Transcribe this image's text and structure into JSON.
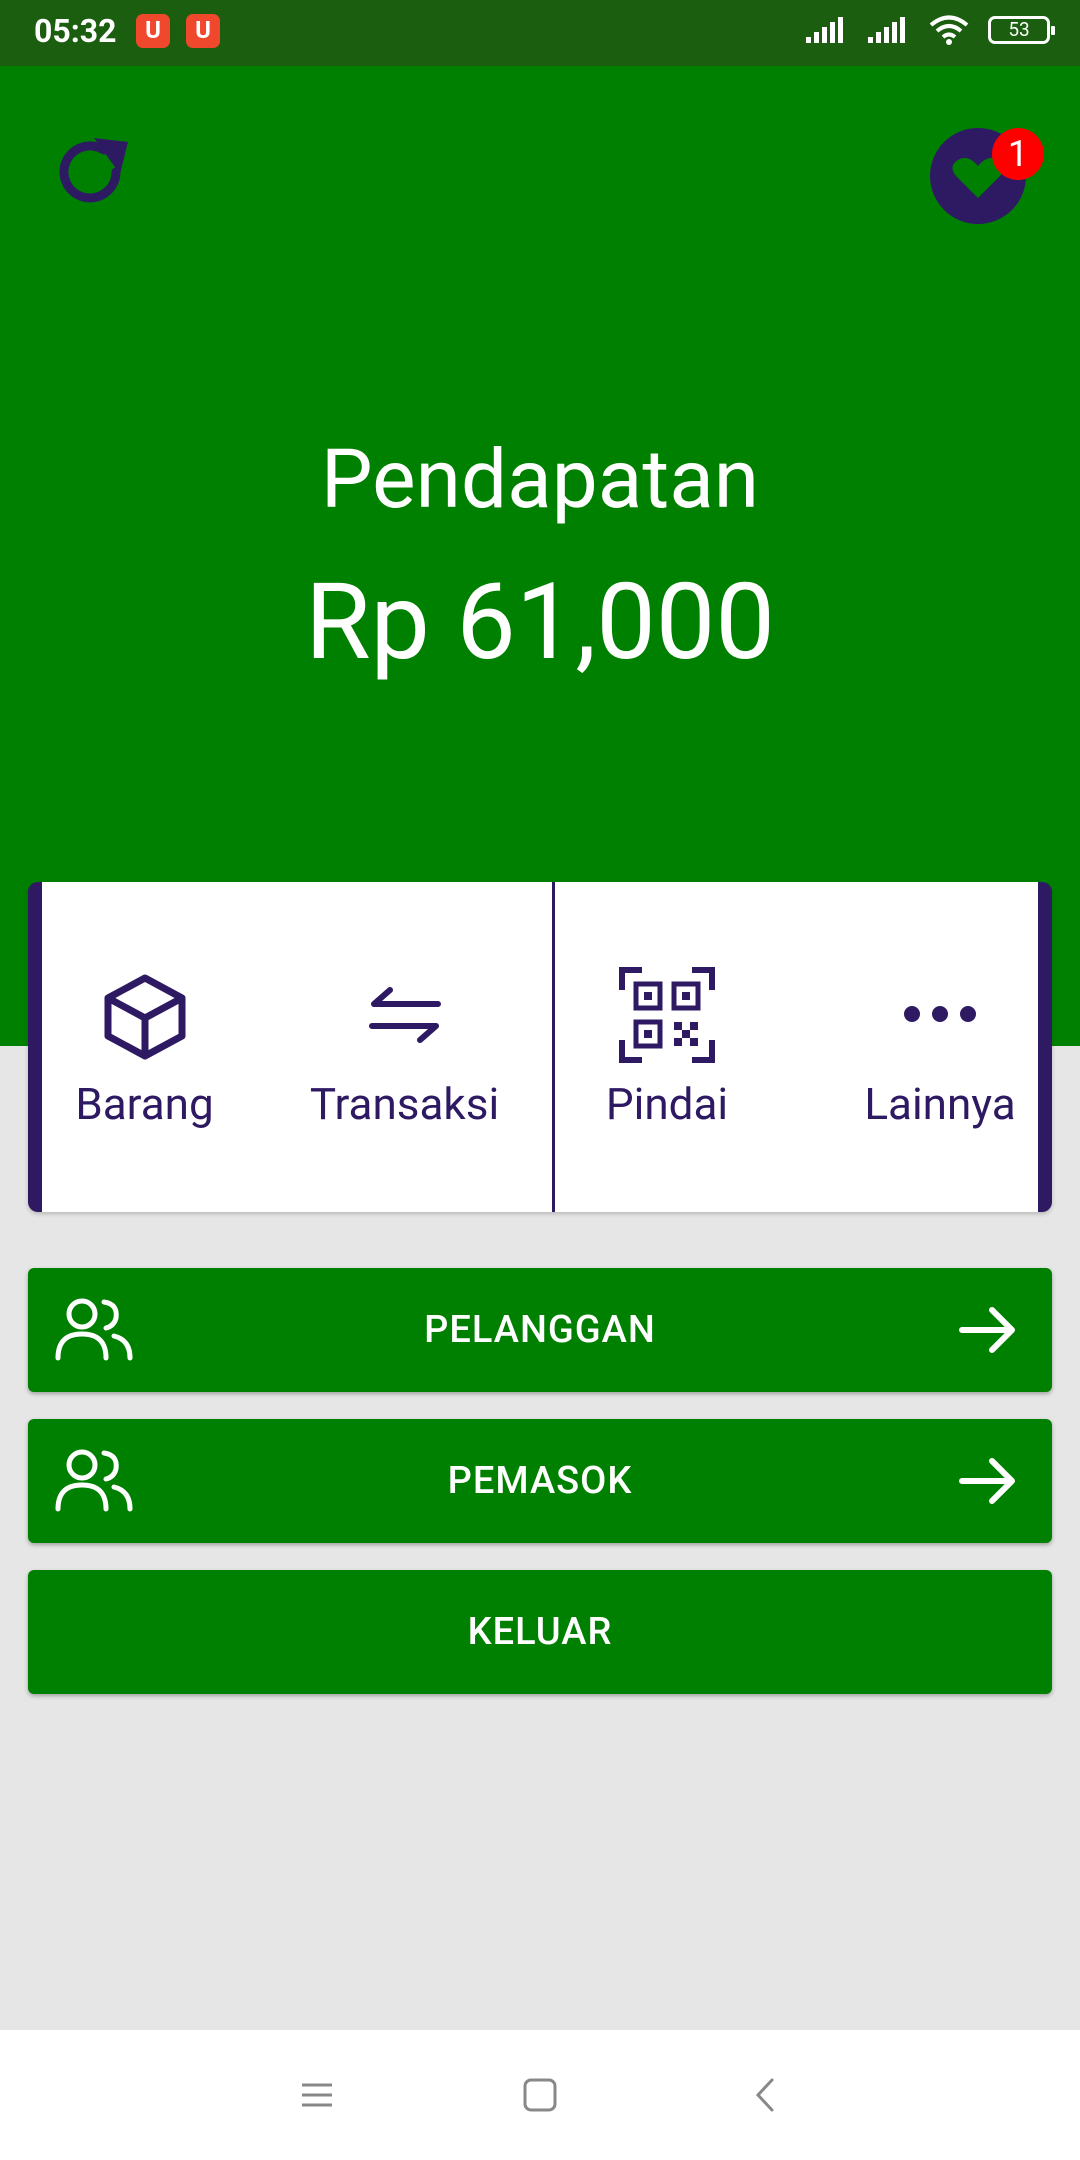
{
  "status_bar": {
    "time": "05:32",
    "notification_icons": [
      "U",
      "U"
    ],
    "battery": "53"
  },
  "header": {
    "income_label": "Pendapatan",
    "income_value": "Rp 61,000",
    "badge_count": "1"
  },
  "menu": {
    "items": [
      {
        "label": "Barang",
        "icon": "box-icon"
      },
      {
        "label": "Transaksi",
        "icon": "transfer-icon"
      },
      {
        "label": "Pindai",
        "icon": "qr-code-icon"
      },
      {
        "label": "Lainnya",
        "icon": "more-icon"
      }
    ]
  },
  "buttons": {
    "customers": "PELANGGAN",
    "suppliers": "PEMASOK",
    "logout": "KELUAR"
  },
  "colors": {
    "primary_green": "#008000",
    "accent_purple": "#2d1a63",
    "badge_red": "#ff0000",
    "background": "#e6e6e6"
  }
}
